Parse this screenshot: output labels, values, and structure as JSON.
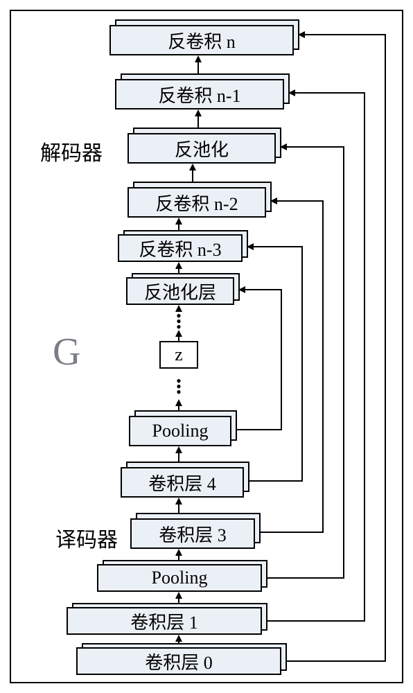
{
  "outer_label": "G",
  "section_labels": {
    "decoder": "解码器",
    "encoder": "译码器"
  },
  "layers": {
    "deconv_n": "反卷积 n",
    "deconv_n1": "反卷积 n-1",
    "unpool_top": "反池化",
    "deconv_n2": "反卷积 n-2",
    "deconv_n3": "反卷积 n-3",
    "unpool_mid": "反池化层",
    "z": "z",
    "pool_top": "Pooling",
    "conv4": "卷积层 4",
    "conv3": "卷积层 3",
    "pool_bot": "Pooling",
    "conv1": "卷积层 1",
    "conv0": "卷积层 0"
  }
}
